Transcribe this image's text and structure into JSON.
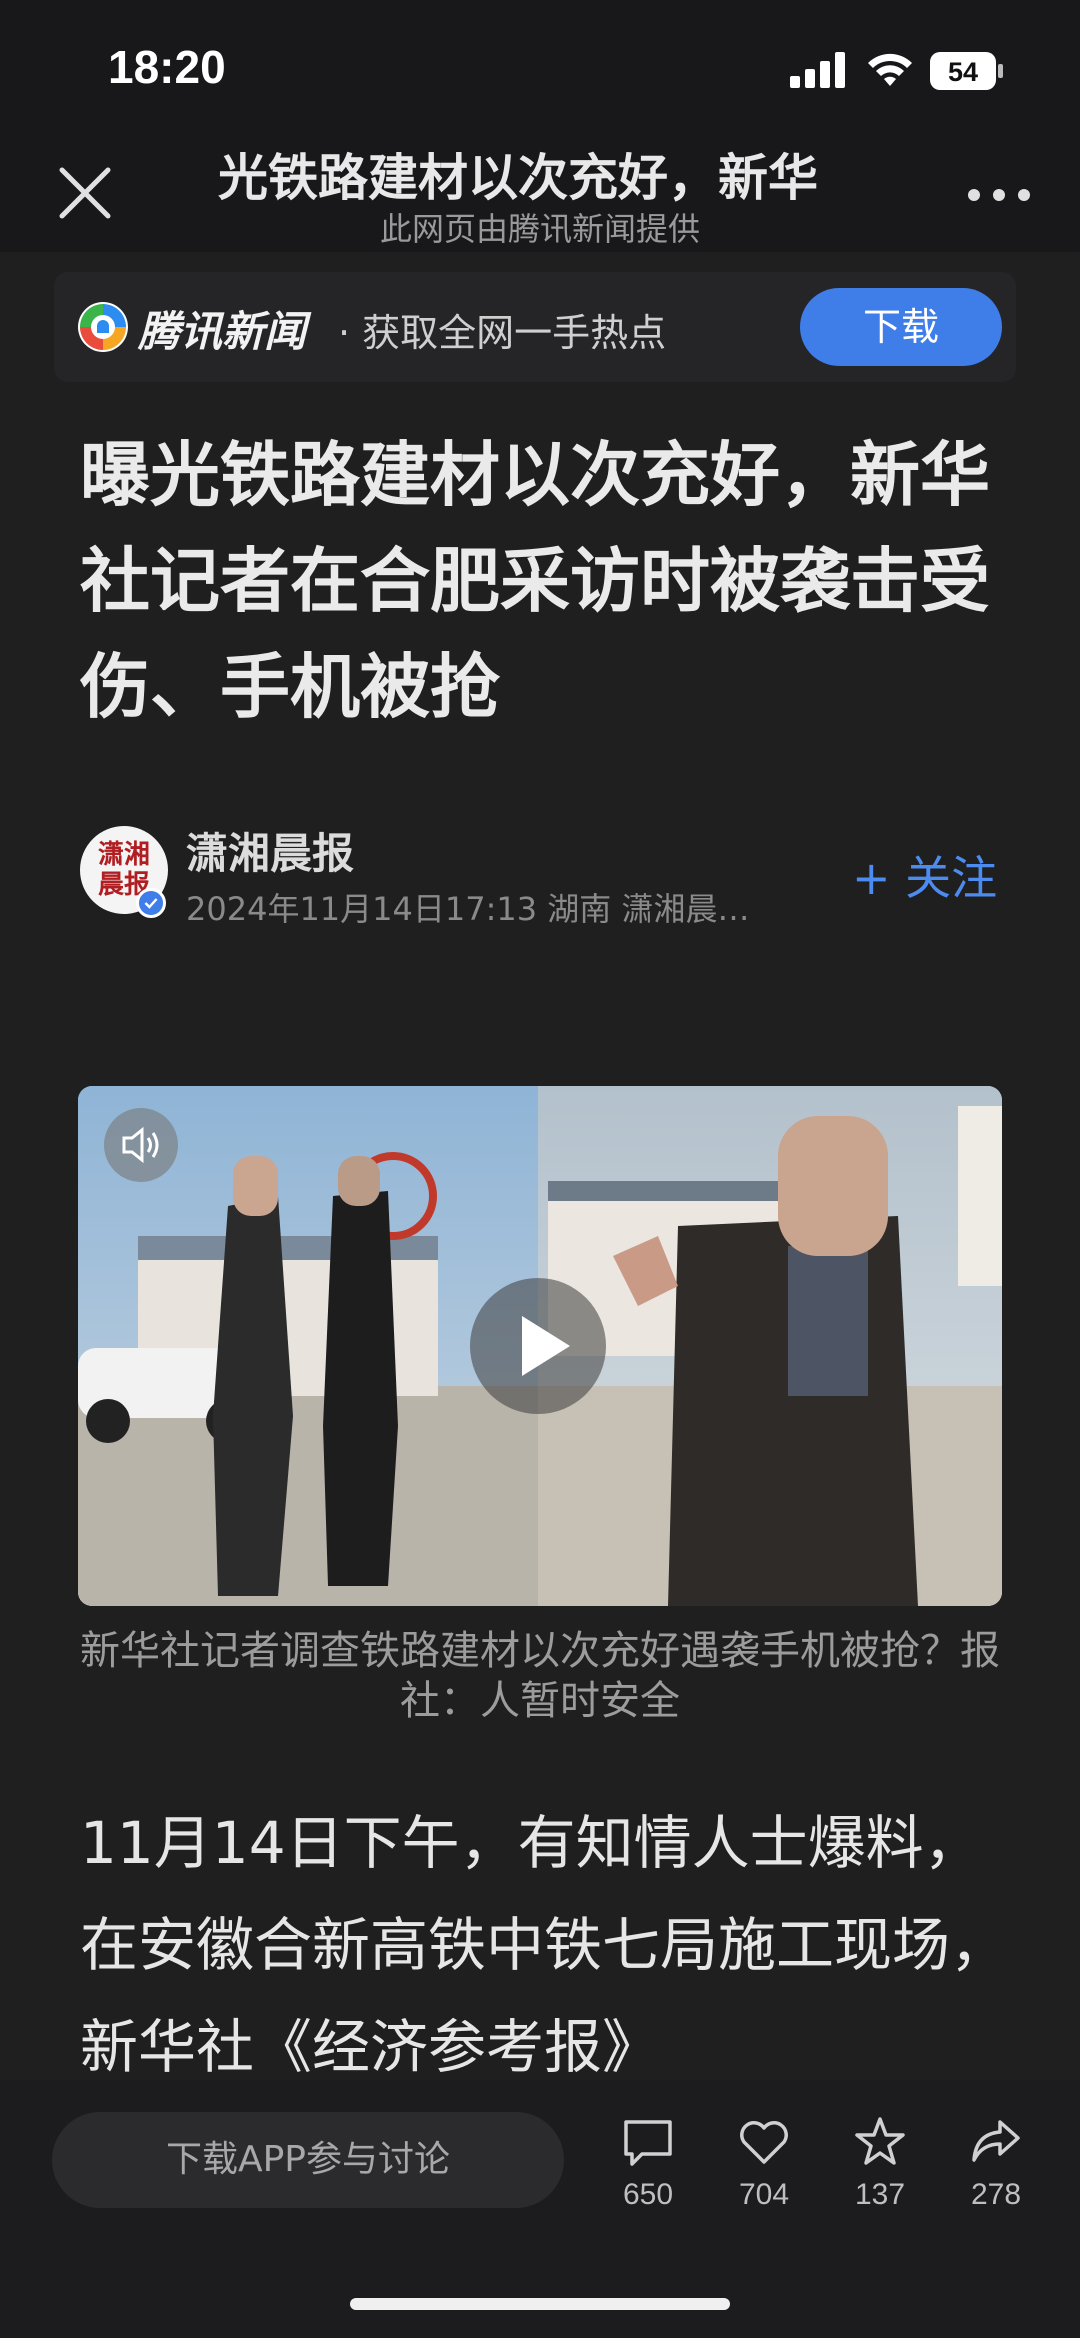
{
  "status_bar": {
    "time": "18:20",
    "battery": "54"
  },
  "nav": {
    "title": "光铁路建材以次充好，新华",
    "subtitle": "此网页由腾讯新闻提供"
  },
  "banner": {
    "brand": "腾讯新闻",
    "slogan": "· 获取全网一手热点",
    "download_label": "下载"
  },
  "article": {
    "headline": "曝光铁路建材以次充好，新华社记者在合肥采访时被袭击受伤、手机被抢",
    "author": {
      "name": "潇湘晨报",
      "avatar_text": "潇湘晨报",
      "meta": "2024年11月14日17:13  湖南  潇湘晨…",
      "follow_label": "+ 关注"
    },
    "video_caption": "新华社记者调查铁路建材以次充好遇袭手机被抢？报社：人暂时安全",
    "body": "11月14日下午，有知情人士爆料，在安徽合新高铁中铁七局施工现场，新华社《经济参考报》"
  },
  "bottom_bar": {
    "comment_placeholder": "下载APP参与讨论",
    "comment_count": "650",
    "like_count": "704",
    "favorite_count": "137",
    "share_count": "278"
  },
  "icons": [
    "close-icon",
    "more-icon",
    "tencent-news-logo-icon",
    "sound-icon",
    "play-icon",
    "comment-icon",
    "heart-icon",
    "star-icon",
    "share-icon"
  ],
  "colors": {
    "accent": "#3f7de8",
    "follow": "#4c8cf0",
    "background": "#1f1f20"
  }
}
